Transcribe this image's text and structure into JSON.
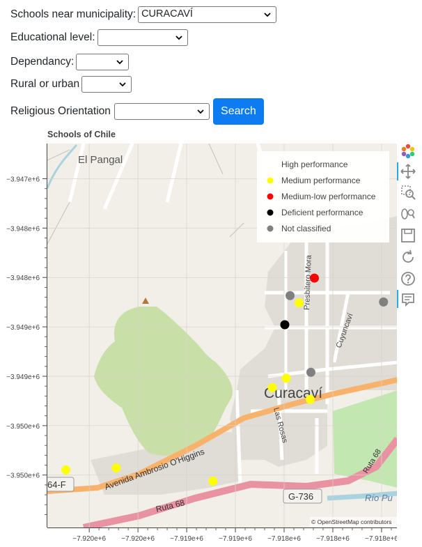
{
  "form": {
    "municipality": {
      "label": "Schools near municipality:",
      "value": "CURACAVÍ"
    },
    "educational_level": {
      "label": "Educational level:",
      "value": ""
    },
    "dependancy": {
      "label": "Dependancy:",
      "value": ""
    },
    "rural_urban": {
      "label": "Rural or urban",
      "value": ""
    },
    "religious": {
      "label": "Religious Orientation",
      "value": ""
    },
    "search_label": "Search"
  },
  "chart_data": {
    "type": "scatter",
    "title": "Schools of Chile",
    "xlim": [
      -7920780,
      -7917185
    ],
    "ylim": [
      -3950531,
      -3946644
    ],
    "x_ticks": [
      {
        "v": -7920350,
        "label": "−7.920e+6"
      },
      {
        "v": -7919850,
        "label": "−7.920e+6"
      },
      {
        "v": -7919350,
        "label": "−7.919e+6"
      },
      {
        "v": -7918850,
        "label": "−7.919e+6"
      },
      {
        "v": -7918350,
        "label": "−7.918e+6"
      },
      {
        "v": -7917850,
        "label": "−7.918e+6"
      },
      {
        "v": -7917350,
        "label": "−7.918e+6"
      }
    ],
    "y_ticks": [
      {
        "v": -3947000,
        "label": "−3.947e+6"
      },
      {
        "v": -3947500,
        "label": "−3.948e+6"
      },
      {
        "v": -3948000,
        "label": "−3.948e+6"
      },
      {
        "v": -3948500,
        "label": "−3.949e+6"
      },
      {
        "v": -3949000,
        "label": "−3.949e+6"
      },
      {
        "v": -3949500,
        "label": "−3.950e+6"
      },
      {
        "v": -3950000,
        "label": "−3.950e+6"
      }
    ],
    "legend": {
      "placement": "top-right",
      "items": [
        {
          "name": "High performance",
          "color": ""
        },
        {
          "name": "Medium performance",
          "color": "#ffff00"
        },
        {
          "name": "Medium-low performance",
          "color": "#ff0000"
        },
        {
          "name": "Deficient performance",
          "color": "#000000"
        },
        {
          "name": "Not classified",
          "color": "#808080"
        }
      ]
    },
    "series": [
      {
        "name": "Medium performance",
        "color": "#ffff00",
        "points": [
          [
            -7918196,
            -3948257
          ],
          [
            -7918328,
            -3949020
          ],
          [
            -7918471,
            -3949115
          ],
          [
            -7918082,
            -3949234
          ],
          [
            -7920590,
            -3949948
          ],
          [
            -7920073,
            -3949928
          ],
          [
            -7919081,
            -3950062
          ]
        ]
      },
      {
        "name": "Medium-low performance",
        "color": "#ff0000",
        "points": [
          [
            -7918039,
            -3948006
          ]
        ]
      },
      {
        "name": "Deficient performance",
        "color": "#000000",
        "points": [
          [
            -7918343,
            -3948478
          ]
        ]
      },
      {
        "name": "Not classified",
        "color": "#808080",
        "points": [
          [
            -7918289,
            -3948184
          ],
          [
            -7917330,
            -3948248
          ],
          [
            -7918075,
            -3948960
          ]
        ]
      }
    ],
    "map_labels": {
      "town": "Curacaví",
      "el_pangal": "El Pangal",
      "avenida": "Avenida Ambrosio O'Higgins",
      "ruta68": "Ruta 68",
      "ruta68b": "Ruta 68",
      "g736": "G-736",
      "f64": "64-F",
      "rio": "Río Pu",
      "presbitero": "Presbítero Mora",
      "cuyuncavi": "Cuyuncaví",
      "las_rosas": "Las Rosas",
      "attribution": "© OpenStreetMap contributors"
    },
    "colors": {
      "land": "#f2efe9",
      "park": "#c8dfa8",
      "urban": "#e0dcd6",
      "water": "#aad3df",
      "motorway": "#e892a2",
      "trunk": "#f9b26c",
      "green": "#c3e7b0"
    }
  }
}
